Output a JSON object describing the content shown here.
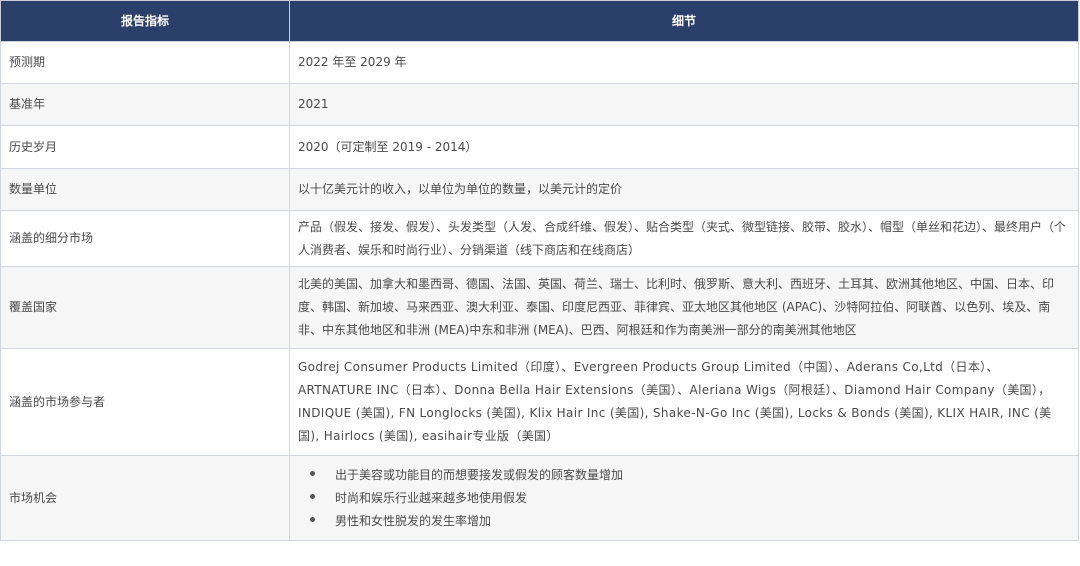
{
  "headers": {
    "metric": "报告指标",
    "details": "细节"
  },
  "rows": [
    {
      "metric": "预测期",
      "detail": "2022 年至 2029 年"
    },
    {
      "metric": "基准年",
      "detail": "2021"
    },
    {
      "metric": "历史岁月",
      "detail": "2020（可定制至 2019 - 2014）"
    },
    {
      "metric": "数量单位",
      "detail": "以十亿美元计的收入，以单位为单位的数量，以美元计的定价"
    },
    {
      "metric": "涵盖的细分市场",
      "detail": "产品（假发、接发、假发）、头发类型（人发、合成纤维、假发）、贴合类型（夹式、微型链接、胶带、胶水）、帽型（单丝和花边）、最终用户（个人消费者、娱乐和时尚行业）、分销渠道（线下商店和在线商店）"
    },
    {
      "metric": "覆盖国家",
      "detail": "北美的美国、加拿大和墨西哥、德国、法国、英国、荷兰、瑞士、比利时、俄罗斯、意大利、西班牙、土耳其、欧洲其他地区、中国、日本、印度、韩国、新加坡、马来西亚、澳大利亚、泰国、印度尼西亚、菲律宾、亚太地区其他地区 (APAC)、沙特阿拉伯、阿联酋、以色列、埃及、南非、中东其他地区和非洲 (MEA)中东和非洲 (MEA)、巴西、阿根廷和作为南美洲一部分的南美洲其他地区"
    },
    {
      "metric": "涵盖的市场参与者",
      "detail": "Godrej Consumer Products Limited（印度）、Evergreen Products Group Limited（中国）、Aderans Co,Ltd（日本）、ARTNATURE INC（日本）、Donna Bella Hair Extensions（美国）、Aleriana Wigs（阿根廷）、Diamond Hair Company（美国），INDIQUE (美国), FN Longlocks (美国), Klix Hair Inc (美国), Shake-N-Go Inc (美国), Locks & Bonds (美国), KLIX HAIR, INC (美国), Hairlocs (美国), easihair专业版（美国）"
    }
  ],
  "opportunities": {
    "metric": "市场机会",
    "items": [
      "出于美容或功能目的而想要接发或假发的顾客数量增加",
      "时尚和娱乐行业越来越多地使用假发",
      "男性和女性脱发的发生率增加"
    ]
  }
}
